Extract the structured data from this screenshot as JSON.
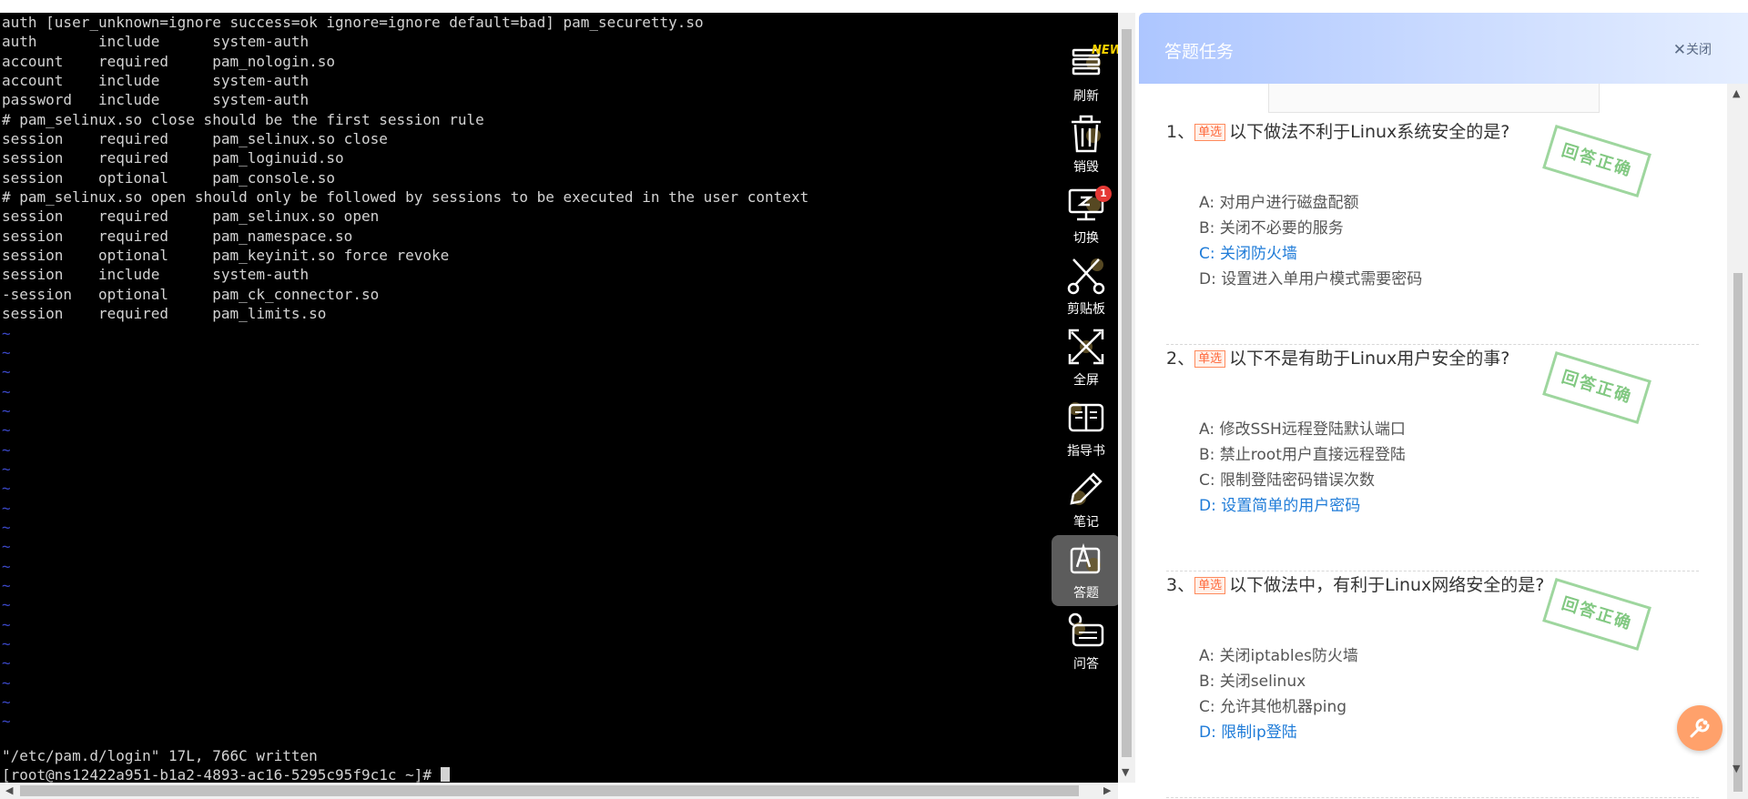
{
  "terminal": {
    "lines": [
      "auth [user_unknown=ignore success=ok ignore=ignore default=bad] pam_securetty.so",
      "auth       include      system-auth",
      "account    required     pam_nologin.so",
      "account    include      system-auth",
      "password   include      system-auth",
      "# pam_selinux.so close should be the first session rule",
      "session    required     pam_selinux.so close",
      "session    required     pam_loginuid.so",
      "session    optional     pam_console.so",
      "# pam_selinux.so open should only be followed by sessions to be executed in the user context",
      "session    required     pam_selinux.so open",
      "session    required     pam_namespace.so",
      "session    optional     pam_keyinit.so force revoke",
      "session    include      system-auth",
      "-session   optional     pam_ck_connector.so",
      "session    required     pam_limits.so"
    ],
    "tilde": "~",
    "written_msg": "\"/etc/pam.d/login\" 17L, 766C written",
    "prompt": "[root@ns12422a951-b1a2-4893-ac16-5295c95f9c1c ~]# "
  },
  "toolbar": {
    "new_tag": "NEW",
    "refresh": "刷新",
    "destroy": "销毁",
    "switch": "切换",
    "switch_badge": "1",
    "clipboard": "剪贴板",
    "fullscreen": "全屏",
    "guide": "指导书",
    "notes": "笔记",
    "answer": "答题",
    "qa": "问答"
  },
  "panel": {
    "title": "答题任务",
    "close": "关闭",
    "stamp": "回答正确",
    "tag": "单选",
    "questions": [
      {
        "num": "1、",
        "text": "以下做法不利于Linux系统安全的是?",
        "options": [
          "A:  对用户进行磁盘配额",
          "B:  关闭不必要的服务",
          "C:  关闭防火墙",
          "D:  设置进入单用户模式需要密码"
        ],
        "correct": 2
      },
      {
        "num": "2、",
        "text": "以下不是有助于Linux用户安全的事?",
        "options": [
          "A:  修改SSH远程登陆默认端口",
          "B:  禁止root用户直接远程登陆",
          "C:  限制登陆密码错误次数",
          "D:  设置简单的用户密码"
        ],
        "correct": 3
      },
      {
        "num": "3、",
        "text": "以下做法中，有利于Linux网络安全的是?",
        "options": [
          "A:  关闭iptables防火墙",
          "B:  关闭selinux",
          "C:  允许其他机器ping",
          "D:  限制ip登陆"
        ],
        "correct": 3
      }
    ]
  }
}
